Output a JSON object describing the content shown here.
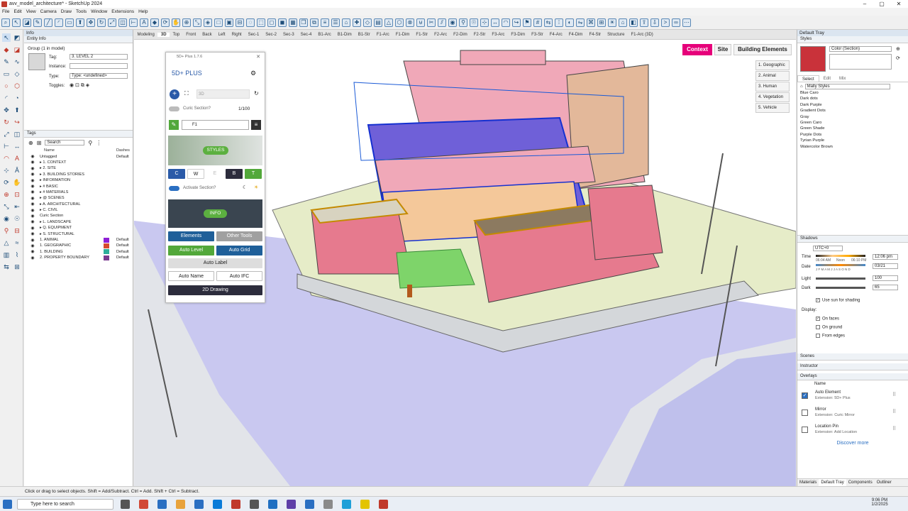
{
  "window": {
    "title": "avv_model_architecture* - SketchUp 2024"
  },
  "menu": [
    "File",
    "Edit",
    "View",
    "Camera",
    "Draw",
    "Tools",
    "Window",
    "Extensions",
    "Help"
  ],
  "entity_info": {
    "panel_title": "Info",
    "section": "Entity Info",
    "group_label": "Group (1 in model)",
    "tag_label": "Tag:",
    "tag_value": "3. LEVEL 2",
    "instance_label": "Instance:",
    "type_label": "Type:",
    "type_value": "Type: <undefined>",
    "toggles_label": "Toggles:"
  },
  "tags": {
    "section": "Tags",
    "search_placeholder": "Search",
    "col_name": "Name",
    "col_dashes": "Dashes",
    "rows": [
      {
        "name": "Untagged",
        "dash": "Default",
        "color": ""
      },
      {
        "name": "▸ 1. CONTEXT",
        "dash": "",
        "color": ""
      },
      {
        "name": "▸ 2. SITE",
        "dash": "",
        "color": ""
      },
      {
        "name": "▸ 3. BUILDING STORIES",
        "dash": "",
        "color": ""
      },
      {
        "name": "▸ INFORMATION",
        "dash": "",
        "color": ""
      },
      {
        "name": "▸ # BASIC",
        "dash": "",
        "color": ""
      },
      {
        "name": "▸ # MATERIALS",
        "dash": "",
        "color": ""
      },
      {
        "name": "▸ @ SCENES",
        "dash": "",
        "color": ""
      },
      {
        "name": "▸ A. ARCHITECTURAL",
        "dash": "",
        "color": ""
      },
      {
        "name": "▸ C. CIVIL",
        "dash": "",
        "color": ""
      },
      {
        "name": "Curic Section",
        "dash": "",
        "color": ""
      },
      {
        "name": "▸ L. LANDSCAPE",
        "dash": "",
        "color": ""
      },
      {
        "name": "▸ Q. EQUIPMENT",
        "dash": "",
        "color": ""
      },
      {
        "name": "▸ S. STRUCTURAL",
        "dash": "",
        "color": ""
      },
      {
        "name": "1. ANIMAL",
        "dash": "Default",
        "color": "#8e1fd6"
      },
      {
        "name": "1. GEOGRAPHIC",
        "dash": "Default",
        "color": "#d64a2e"
      },
      {
        "name": "1. BUILDING",
        "dash": "Default",
        "color": "#2eae9a"
      },
      {
        "name": "2. PROPERTY BOUNDARY",
        "dash": "Default",
        "color": "#7a3b8f"
      }
    ]
  },
  "scene_tabs": [
    "Modeling",
    "3D",
    "Top",
    "Front",
    "Back",
    "Left",
    "Right",
    "Sec-1",
    "Sec-2",
    "Sec-3",
    "Sec-4",
    "B1-Arc",
    "B1-Dim",
    "B1-Str",
    "F1-Arc",
    "F1-Dim",
    "F1-Str",
    "F2-Arc",
    "F2-Dim",
    "F2-Str",
    "F3-Arc",
    "F3-Dim",
    "F3-Str",
    "F4-Arc",
    "F4-Dim",
    "F4-Str",
    "Structure",
    "F1-Arc (3D)"
  ],
  "view_buttons": {
    "context": "Context",
    "site": "Site",
    "building_elements": "Building Elements"
  },
  "view_list": [
    "1. Geographic",
    "2. Animal",
    "3. Human",
    "4. Vegetation",
    "5. Vehicle"
  ],
  "plus": {
    "window_title": "5D+ Plus 1.7.6",
    "brand": "5D+ PLUS",
    "mode": "3D",
    "curic": "Curic Section?",
    "scale": "1/100",
    "floor": "F1",
    "styles": "STYLES",
    "cwebt": [
      "C",
      "W",
      "E",
      "B",
      "T"
    ],
    "activate": "Activate Section?",
    "info": "INFO",
    "elements": "Elements",
    "other_tools": "Other Tools",
    "auto_level": "Auto Level",
    "auto_grid": "Auto Grid",
    "auto_label": "Auto Label",
    "auto_name": "Auto Name",
    "auto_ifc": "Auto IFC",
    "drawing": "2D Drawing"
  },
  "tray": {
    "title": "Default Tray",
    "styles": "Styles",
    "style_name": "Color (Section)",
    "tabs": [
      "Select",
      "Edit",
      "Mix"
    ],
    "collection": "Mally Styles",
    "style_list": [
      "Blue Caro",
      "Dark dots",
      "Dark Purple",
      "Gradient Dots",
      "Gray",
      "Green Caro",
      "Green Shade",
      "Purple Dots",
      "Tyrian Purple",
      "Watercolor Brown"
    ],
    "shadows": "Shadows",
    "utc": "UTC+0",
    "time_label": "Time",
    "time_am": "06:04 AM",
    "time_noon": "Noon",
    "time_pm": "06:10 PM",
    "time_value": "12:06 pm",
    "date_label": "Date",
    "months": "J F M A M J J A S O N D",
    "date_value": "03/21",
    "light_label": "Light",
    "light_value": "100",
    "dark_label": "Dark",
    "dark_value": "65",
    "use_sun": "Use sun for shading",
    "display": "Display:",
    "on_faces": "On faces",
    "on_ground": "On ground",
    "from_edges": "From edges",
    "scenes": "Scenes",
    "instructor": "Instructor",
    "overlays": "Overlays",
    "overlay_col": "Name",
    "overlay_items": [
      {
        "name": "Auto Element",
        "ext": "Extension: 5D+ Plus",
        "checked": true
      },
      {
        "name": "Mirror",
        "ext": "Extension: Curic Mirror",
        "checked": false
      },
      {
        "name": "Location Pin",
        "ext": "Extension: Add Location",
        "checked": false
      }
    ],
    "discover": "Discover more",
    "bottom_tabs": [
      "Materials",
      "Default Tray",
      "Components",
      "Outliner"
    ]
  },
  "status": "Click or drag to select objects. Shift = Add/Subtract. Ctrl = Add. Shift + Ctrl = Subtract.",
  "taskbar": {
    "search": "Type here to search",
    "time": "9:06 PM",
    "date": "1/2/2025"
  }
}
